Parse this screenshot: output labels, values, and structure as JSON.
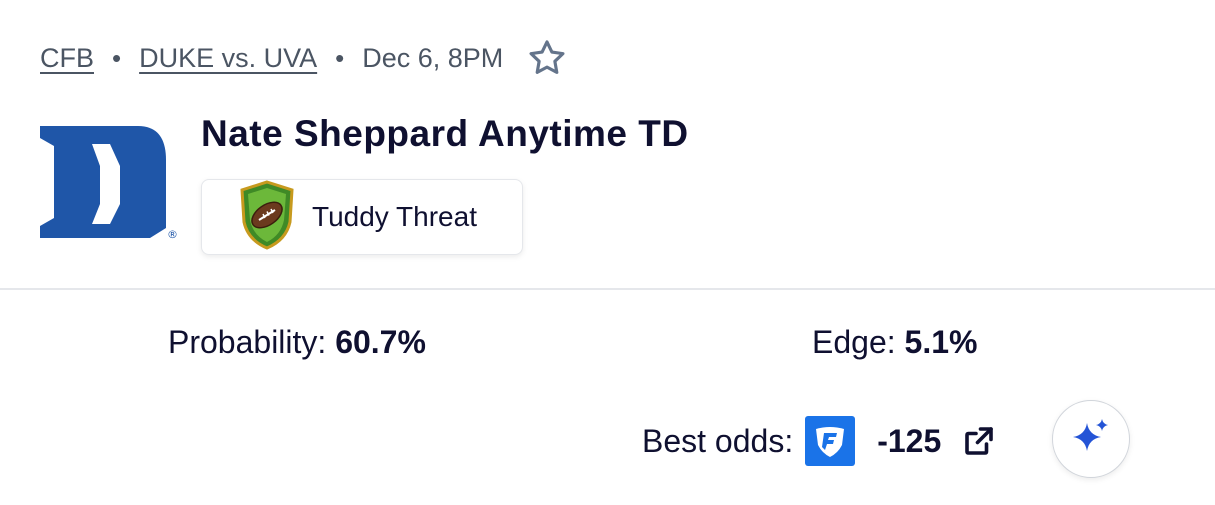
{
  "breadcrumb": {
    "league": "CFB",
    "game": "DUKE vs. UVA",
    "time": "Dec 6, 8PM",
    "separator": "•",
    "favorite_icon": "star-outline-icon"
  },
  "team_logo": {
    "icon": "duke-d-logo",
    "color": "#1f56a8"
  },
  "bet": {
    "title": "Nate Sheppard Anytime TD",
    "badge": {
      "label": "Tuddy Threat",
      "icon": "football-shield-icon"
    }
  },
  "stats": {
    "probability_label": "Probability:",
    "probability_value": "60.7%",
    "edge_label": "Edge:",
    "edge_value": "5.1%"
  },
  "odds": {
    "label": "Best odds:",
    "book_icon": "fanduel-icon",
    "book_color": "#1a73e8",
    "value": "-125",
    "external_icon": "external-link-icon"
  },
  "ai_button": {
    "icon": "sparkle-icon",
    "color": "#2454d6"
  }
}
